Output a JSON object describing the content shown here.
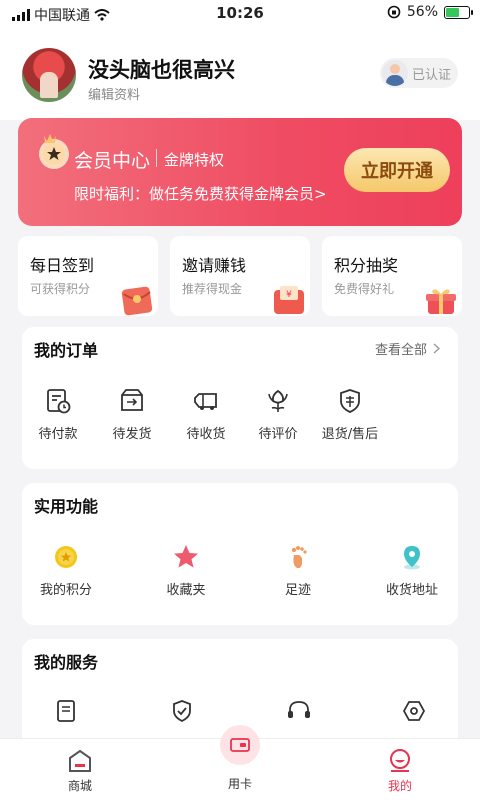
{
  "status_bar": {
    "carrier": "中国联通",
    "time": "10:26",
    "battery": "56%",
    "battery_level": 0.56
  },
  "profile": {
    "username": "没头脑也很高兴",
    "edit_label": "编辑资料",
    "verified_label": "已认证"
  },
  "member_banner": {
    "title": "会员中心",
    "subtitle": "金牌特权",
    "tip": "限时福利：做任务免费获得金牌会员>",
    "button_label": "立即开通"
  },
  "quick_cards": [
    {
      "title": "每日签到",
      "subtitle": "可获得积分",
      "icon": "red-envelope-icon"
    },
    {
      "title": "邀请赚钱",
      "subtitle": "推荐得现金",
      "icon": "cash-envelope-icon"
    },
    {
      "title": "积分抽奖",
      "subtitle": "免费得好礼",
      "icon": "gift-box-icon"
    }
  ],
  "orders": {
    "title": "我的订单",
    "see_all": "查看全部",
    "items": [
      {
        "label": "待付款",
        "icon": "pending-payment-icon"
      },
      {
        "label": "待发货",
        "icon": "pending-shipment-icon"
      },
      {
        "label": "待收货",
        "icon": "delivery-truck-icon"
      },
      {
        "label": "待评价",
        "icon": "flower-review-icon"
      },
      {
        "label": "退货/售后",
        "icon": "after-sales-shield-icon"
      }
    ]
  },
  "tools": {
    "title": "实用功能",
    "items": [
      {
        "label": "我的积分",
        "icon": "points-coin-icon"
      },
      {
        "label": "收藏夹",
        "icon": "star-icon"
      },
      {
        "label": "足迹",
        "icon": "footprint-icon"
      },
      {
        "label": "收货地址",
        "icon": "location-pin-icon"
      }
    ]
  },
  "services": {
    "title": "我的服务"
  },
  "tabbar": {
    "items": [
      {
        "label": "商城",
        "icon": "shop-icon"
      },
      {
        "label": "用卡",
        "icon": "card-icon"
      },
      {
        "label": "我的",
        "icon": "profile-icon"
      }
    ],
    "active_color": "#e8344e"
  }
}
